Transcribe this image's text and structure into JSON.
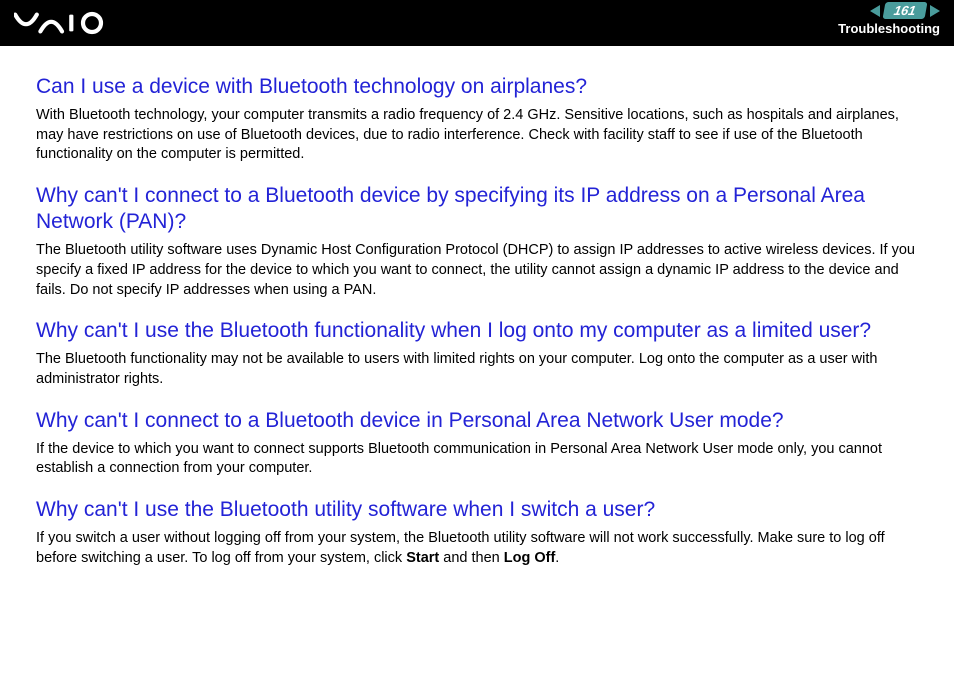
{
  "header": {
    "page_number": "161",
    "section": "Troubleshooting"
  },
  "faq": [
    {
      "q": "Can I use a device with Bluetooth technology on airplanes?",
      "a": "With Bluetooth technology, your computer transmits a radio frequency of 2.4 GHz. Sensitive locations, such as hospitals and airplanes, may have restrictions on use of Bluetooth devices, due to radio interference. Check with facility staff to see if use of the Bluetooth functionality on the computer is permitted."
    },
    {
      "q": "Why can't I connect to a Bluetooth device by specifying its IP address on a Personal Area Network (PAN)?",
      "a": "The Bluetooth utility software uses Dynamic Host Configuration Protocol (DHCP) to assign IP addresses to active wireless devices. If you specify a fixed IP address for the device to which you want to connect, the utility cannot assign a dynamic IP address to the device and fails. Do not specify IP addresses when using a PAN."
    },
    {
      "q": "Why can't I use the Bluetooth functionality when I log onto my computer as a limited user?",
      "a": "The Bluetooth functionality may not be available to users with limited rights on your computer. Log onto the computer as a user with administrator rights."
    },
    {
      "q": "Why can't I connect to a Bluetooth device in Personal Area Network User mode?",
      "a": "If the device to which you want to connect supports Bluetooth communication in Personal Area Network User mode only, you cannot establish a connection from your computer."
    },
    {
      "q": "Why can't I use the Bluetooth utility software when I switch a user?",
      "a_parts": {
        "pre": "If you switch a user without logging off from your system, the Bluetooth utility software will not work successfully. Make sure to log off before switching a user. To log off from your system, click ",
        "b1": "Start",
        "mid": " and then ",
        "b2": "Log Off",
        "post": "."
      }
    }
  ]
}
